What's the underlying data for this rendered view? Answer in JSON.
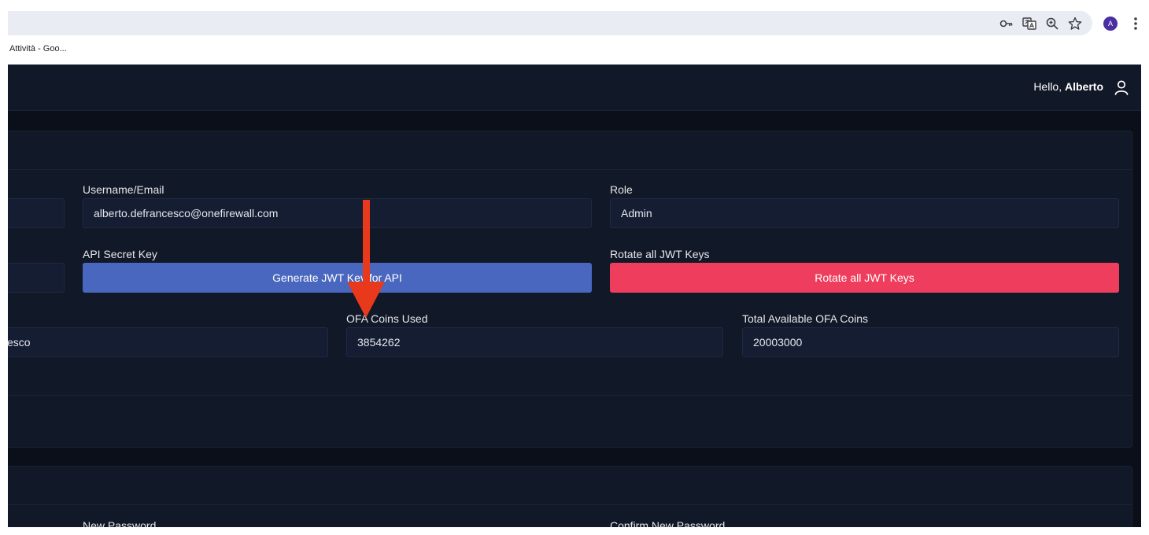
{
  "browser": {
    "bookmark_label": "Attività - Goo...",
    "avatar_letter": "A",
    "icons": [
      "key-icon",
      "translate-icon",
      "zoom-icon",
      "star-icon",
      "kebab-menu-icon"
    ]
  },
  "header": {
    "greeting": "Hello,",
    "user_name": "Alberto",
    "user_icon": "user-icon"
  },
  "profile": {
    "username_label": "Username/Email",
    "username_value": "alberto.defrancesco@onefirewall.com",
    "role_label": "Role",
    "role_value": "Admin",
    "api_secret_label": "API Secret Key",
    "generate_button": "Generate JWT Key for API",
    "rotate_label": "Rotate all JWT Keys",
    "rotate_button": "Rotate all JWT Keys",
    "left_field_value": "esco",
    "coins_used_label": "OFA Coins Used",
    "coins_used_value": "3854262",
    "coins_available_label": "Total Available OFA Coins",
    "coins_available_value": "20003000"
  },
  "password": {
    "new_password_label": "New Password",
    "confirm_password_label": "Confirm New Password"
  },
  "colors": {
    "app_background": "#0b0f19",
    "card_background": "#111827",
    "primary_button": "#4a67bf",
    "danger_button": "#ef3e5d",
    "annotation_arrow": "#e8391d"
  }
}
